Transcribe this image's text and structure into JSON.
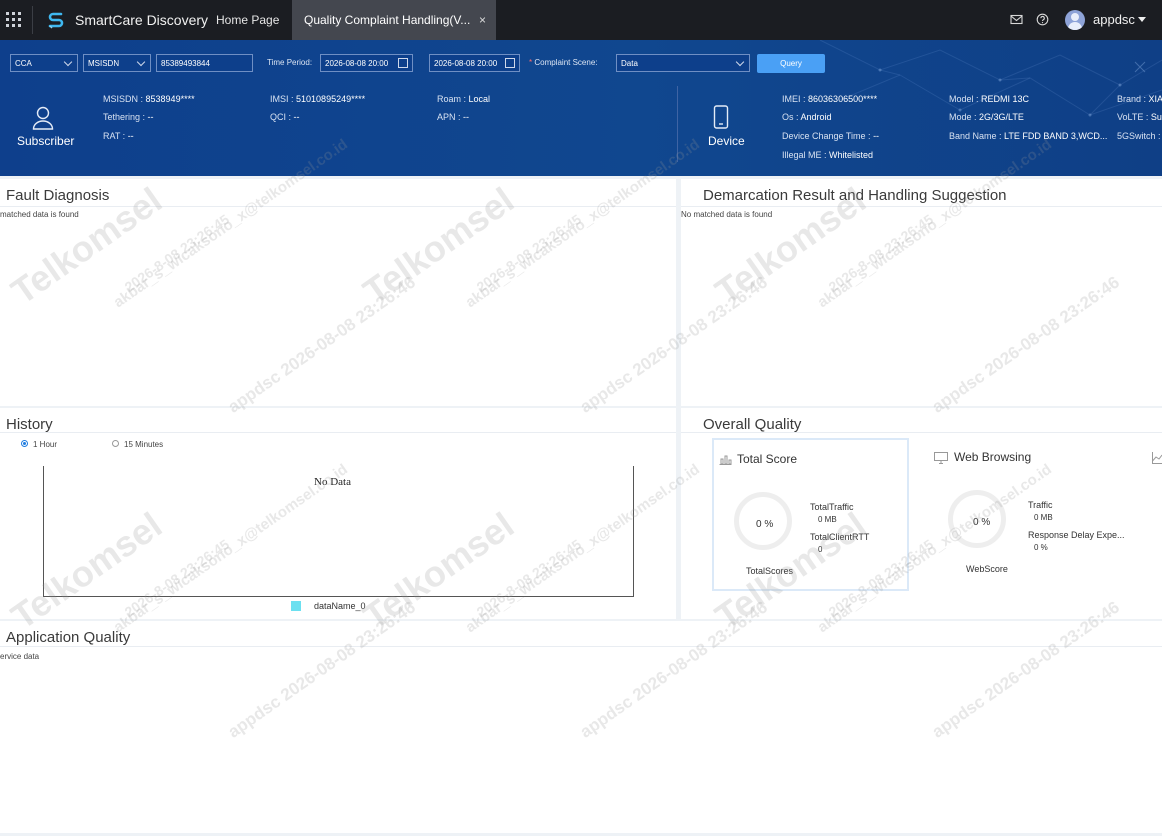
{
  "topbar": {
    "brand": "SmartCare Discovery",
    "tabs": [
      {
        "label": "Home Page"
      },
      {
        "label": "Quality Complaint Handling(V..."
      }
    ],
    "close_glyph": "×",
    "user": "appdsc",
    "icons": [
      "apps-grid-icon",
      "mail-icon",
      "help-icon"
    ]
  },
  "query": {
    "region": "CCA",
    "id_type": "MSISDN",
    "number": "85389493844",
    "time_label": "Time Period:",
    "start": "2026-08-08 20:00",
    "end": "2026-08-08 20:00",
    "scene_star": "*",
    "scene_label": "Complaint Scene:",
    "scene": "Data",
    "query_btn": "Query"
  },
  "subscriber": {
    "title": "Subscriber",
    "rows": [
      {
        "k": "MSISDN",
        "v": "8538949****"
      },
      {
        "k": "Tethering",
        "v": "--"
      },
      {
        "k": "RAT",
        "v": "--"
      },
      {
        "k": "IMSI",
        "v": "51010895249****"
      },
      {
        "k": "QCI",
        "v": "--"
      },
      {
        "k": "Roam",
        "v": "Local"
      },
      {
        "k": "APN",
        "v": "--"
      }
    ]
  },
  "device": {
    "title": "Device",
    "rows": [
      {
        "k": "IMEI",
        "v": "86036306500****"
      },
      {
        "k": "Os",
        "v": "Android"
      },
      {
        "k": "Device Change Time",
        "v": "--"
      },
      {
        "k": "Illegal ME",
        "v": "Whitelisted"
      },
      {
        "k": "Model",
        "v": "REDMI 13C"
      },
      {
        "k": "Mode",
        "v": "2G/3G/LTE"
      },
      {
        "k": "Band Name",
        "v": "LTE FDD BAND 3,WCD..."
      },
      {
        "k": "Brand",
        "v": "XIA"
      },
      {
        "k": "VoLTE",
        "v": "Sup"
      },
      {
        "k": "5GSwitch",
        "v": "Su"
      }
    ]
  },
  "panels": {
    "fault": {
      "title": "Fault Diagnosis",
      "msg": "matched data is found"
    },
    "demarcation": {
      "title": "Demarcation Result and Handling Suggestion",
      "msg": "No matched data is found"
    },
    "history": {
      "title": "History",
      "opt1": "1 Hour",
      "opt2": "15 Minutes",
      "selected": "1 Hour",
      "nodata": "No Data",
      "legend": "dataName_0",
      "legend_color": "#6ce0f0"
    },
    "overall": {
      "title": "Overall Quality",
      "total": {
        "title": "Total Score",
        "pct": "0 %",
        "caption": "TotalScores",
        "m1": "TotalTraffic",
        "v1": "0 MB",
        "m2": "TotalClientRTT",
        "v2": "0"
      },
      "web": {
        "title": "Web Browsing",
        "pct": "0 %",
        "caption": "WebScore",
        "m1": "Traffic",
        "v1": "0 MB",
        "m2": "Response Delay Expe...",
        "v2": "0 %"
      }
    },
    "app": {
      "title": "Application Quality",
      "msg": "ervice data"
    }
  },
  "watermark": {
    "brand": "Telkomsel",
    "email": "akbar_s_wicaksono_x@telkomsel.co.id",
    "stamp": "2026-8-08 23:26:45",
    "user_stamp": "appdsc 2026-08-08 23:26:46"
  },
  "colors": {
    "band": "#0e3f8c",
    "accent": "#4aa0f5",
    "topbar": "#1b1d22"
  }
}
